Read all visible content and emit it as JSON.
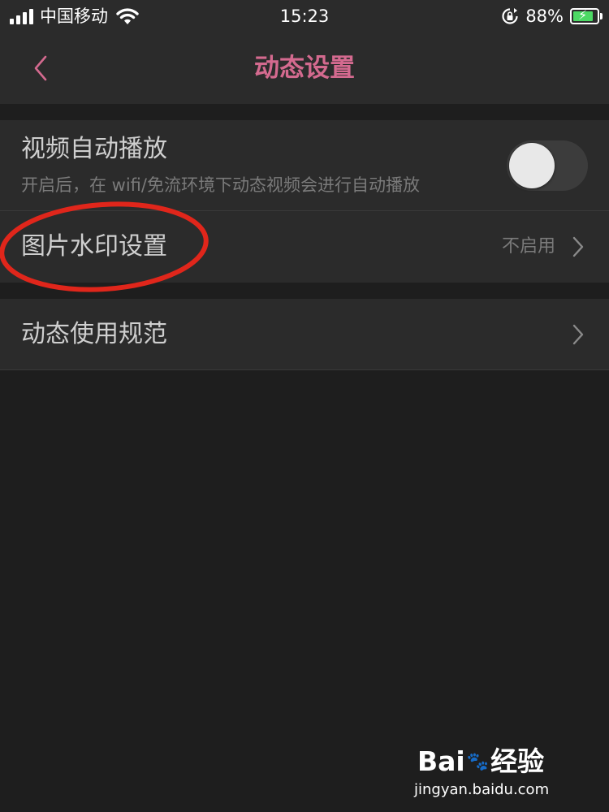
{
  "status_bar": {
    "carrier": "中国移动",
    "time": "15:23",
    "battery_percent": "88%",
    "icons": [
      "signal-icon",
      "wifi-icon",
      "rotation-lock-icon",
      "battery-charging-icon"
    ]
  },
  "nav": {
    "title": "动态设置",
    "back_icon": "chevron-left-icon"
  },
  "settings": {
    "autoplay": {
      "title": "视频自动播放",
      "subtitle": "开启后，在 wifi/免流环境下动态视频会进行自动播放",
      "enabled": false
    },
    "watermark": {
      "title": "图片水印设置",
      "value": "不启用"
    },
    "guidelines": {
      "title": "动态使用规范"
    }
  },
  "watermark_logo": {
    "text_bai": "Bai",
    "text_jingyan": "经验",
    "url": "jingyan.baidu.com"
  },
  "colors": {
    "accent": "#d46a8f",
    "background": "#1e1e1e",
    "panel": "#2b2b2b",
    "annotation": "#e0261b"
  }
}
